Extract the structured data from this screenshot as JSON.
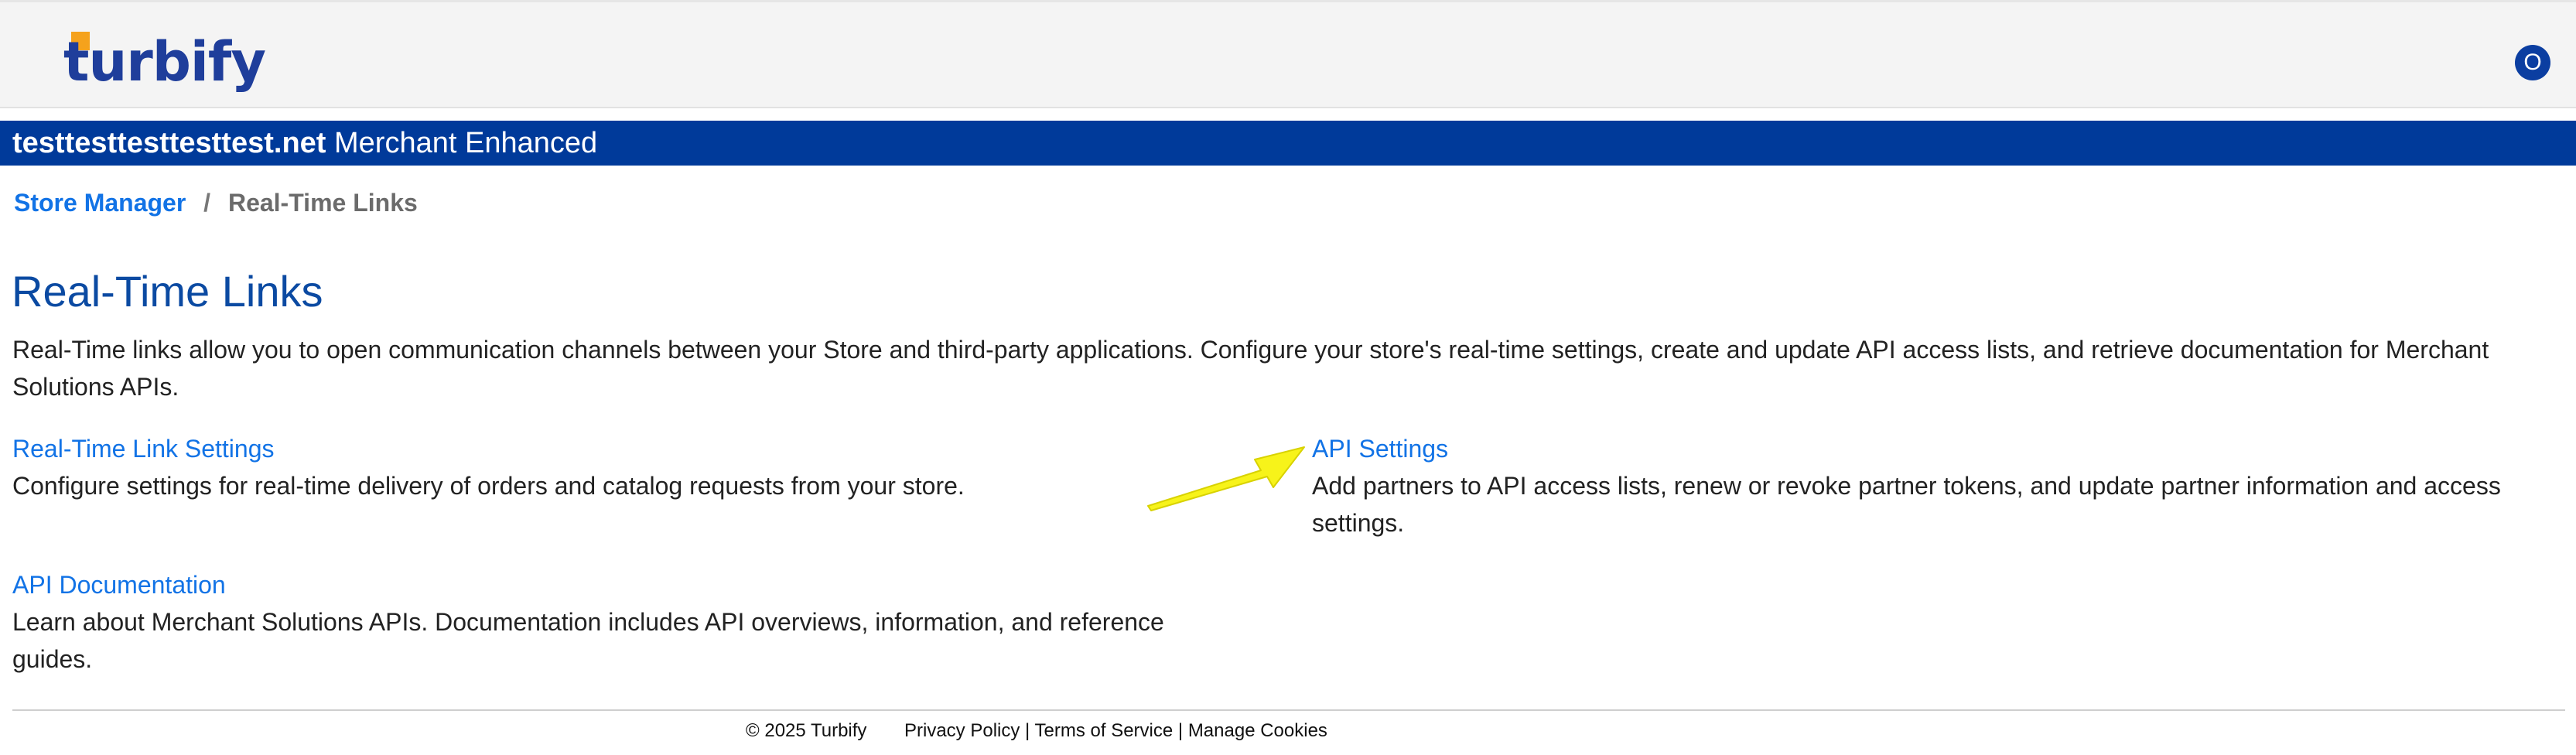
{
  "header": {
    "logo_text": "turbify",
    "avatar_initial": "O",
    "brand_color": "#1f3e9b",
    "accent_color": "#f5a21c"
  },
  "store_bar": {
    "domain": "testtesttesttesttest.net",
    "plan": "Merchant Enhanced",
    "background": "#003a9a"
  },
  "breadcrumb": {
    "parent": "Store Manager",
    "separator": "/",
    "current": "Real-Time Links"
  },
  "page": {
    "title": "Real-Time Links",
    "intro": "Real-Time links allow you to open communication channels between your Store and third-party applications. Configure your store's real-time settings, create and update API access lists, and retrieve documentation for Merchant Solutions APIs."
  },
  "links": {
    "realtime_settings": {
      "label": "Real-Time Link Settings",
      "description": "Configure settings for real-time delivery of orders and catalog requests from your store."
    },
    "api_settings": {
      "label": "API Settings",
      "description": "Add partners to API access lists, renew or revoke partner tokens, and update partner information and access settings."
    },
    "api_documentation": {
      "label": "API Documentation",
      "description": "Learn about Merchant Solutions APIs. Documentation includes API overviews, information, and reference guides."
    }
  },
  "annotation": {
    "arrow_color": "#ffff00",
    "icon": "arrow-pointer-icon"
  },
  "footer": {
    "copyright": "© 2025 Turbify",
    "privacy": "Privacy Policy",
    "sep1": " | ",
    "terms": "Terms of Service",
    "sep2": " | ",
    "cookies": "Manage Cookies"
  }
}
